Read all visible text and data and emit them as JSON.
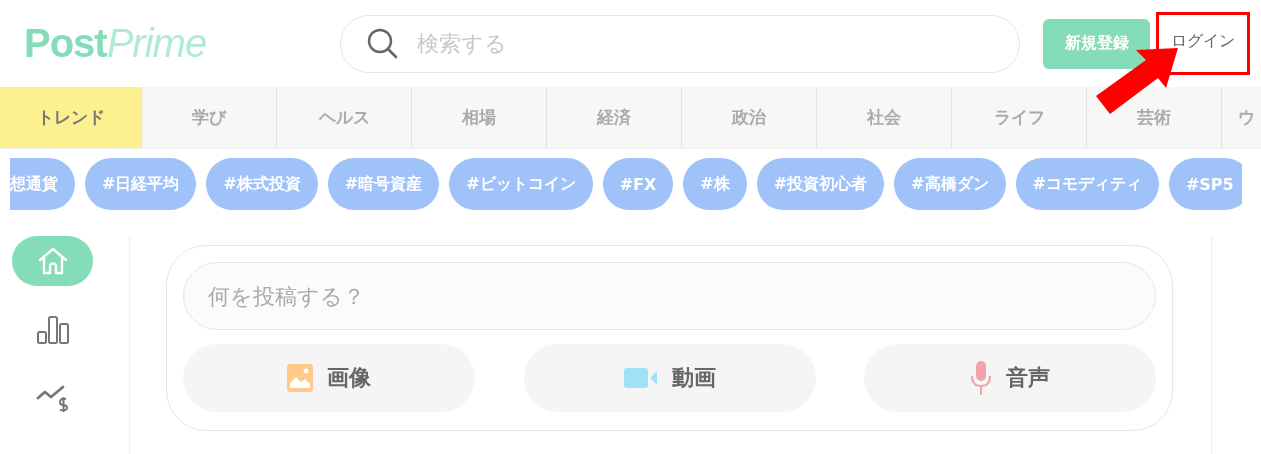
{
  "header": {
    "logo": {
      "first": "Post",
      "second": "Prime"
    },
    "search": {
      "placeholder": "検索する"
    },
    "signup_button": "新規登録",
    "login_button": "ログイン"
  },
  "tabs": [
    {
      "label": "トレンド",
      "selected": true
    },
    {
      "label": "学び",
      "selected": false
    },
    {
      "label": "ヘルス",
      "selected": false
    },
    {
      "label": "相場",
      "selected": false
    },
    {
      "label": "経済",
      "selected": false
    },
    {
      "label": "政治",
      "selected": false
    },
    {
      "label": "社会",
      "selected": false
    },
    {
      "label": "ライフ",
      "selected": false
    },
    {
      "label": "芸術",
      "selected": false
    },
    {
      "label": "ウ",
      "selected": false
    }
  ],
  "tags": [
    "想通貨",
    "#日経平均",
    "#株式投資",
    "#暗号資産",
    "#ビットコイン",
    "#FX",
    "#株",
    "#投資初心者",
    "#高橋ダン",
    "#コモディティ",
    "#SP5"
  ],
  "sidebar": [
    {
      "kind": "home",
      "selected": true
    },
    {
      "kind": "ranking",
      "selected": false
    },
    {
      "kind": "market",
      "selected": false
    }
  ],
  "composer": {
    "placeholder": "何を投稿する？",
    "actions": [
      {
        "kind": "image",
        "label": "画像"
      },
      {
        "kind": "video",
        "label": "動画"
      },
      {
        "kind": "audio",
        "label": "音声"
      }
    ]
  }
}
